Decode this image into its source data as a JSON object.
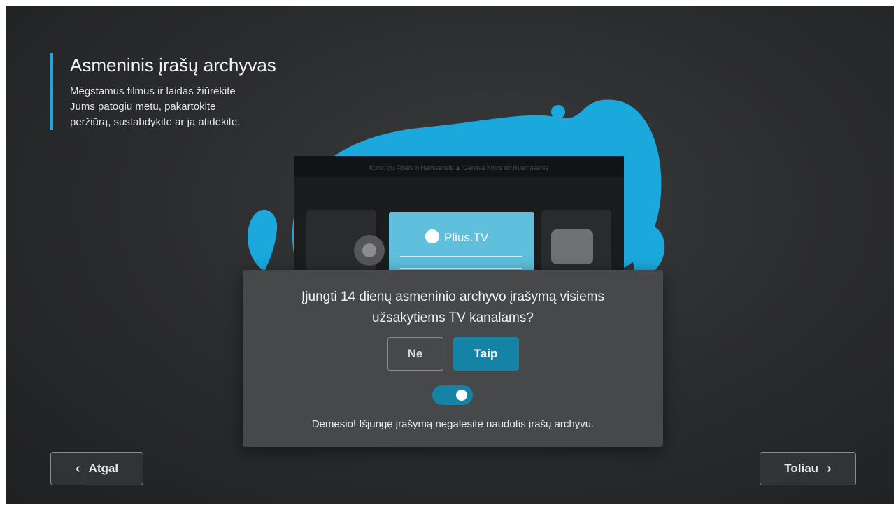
{
  "intro": {
    "title": "Asmeninis įrašų archyvas",
    "line1": "Mėgstamus filmus ir laidas žiūrėkite",
    "line2": "Jums patogiu metu, pakartokite",
    "line3": "peržiūrą, sustabdykite ar ją atidėkite."
  },
  "illustration": {
    "brand": "Plius.TV",
    "cassette_top_text": "Kurso du Fibers n Hanssensis ▲ Geneva Kinos dh Ruemaserss"
  },
  "dialog": {
    "question_line1": "Įjungti 14 dienų asmeninio archyvo įrašymą visiems",
    "question_line2": "užsakytiems TV kanalams?",
    "no_label": "Ne",
    "yes_label": "Taip",
    "toggle_on": true,
    "warning": "Dėmesio! Išjungę įrašymą negalėsite naudotis įrašų archyvu."
  },
  "nav": {
    "back_label": "Atgal",
    "next_label": "Toliau"
  },
  "colors": {
    "accent": "#1ba8dc",
    "button_primary": "#1583a6",
    "dialog_bg": "#47484a",
    "screen_bg": "#2c2d2f"
  }
}
